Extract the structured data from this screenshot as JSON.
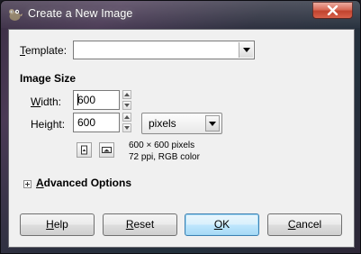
{
  "window": {
    "title": "Create a New Image",
    "icon": "gimp-wilber-icon",
    "close_icon": "close-x-icon"
  },
  "template": {
    "label": "Template:",
    "value": "",
    "options_icon": "chevron-down-icon"
  },
  "image_size": {
    "heading": "Image Size",
    "width_label": "Width:",
    "width_value": "600",
    "height_label": "Height:",
    "height_value": "600",
    "units_value": "pixels",
    "portrait_icon": "portrait-orientation-icon",
    "landscape_icon": "landscape-orientation-icon",
    "info_line1": "600 × 600 pixels",
    "info_line2": "72 ppi, RGB color"
  },
  "advanced": {
    "label": "Advanced Options",
    "expander_icon": "expand-plus-icon"
  },
  "buttons": {
    "help": "Help",
    "reset": "Reset",
    "ok": "OK",
    "cancel": "Cancel"
  },
  "colors": {
    "dialog_bg": "#f0f0f0",
    "close_button": "#c7432b",
    "default_button": "#a7d9f5"
  }
}
